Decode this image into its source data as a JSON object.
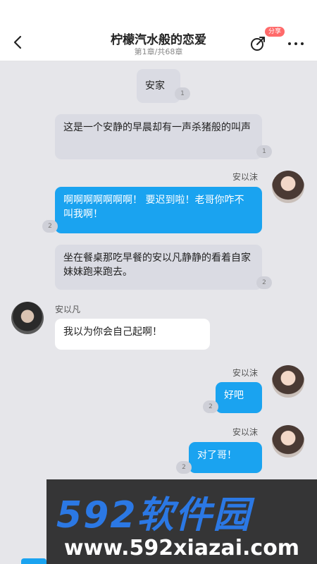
{
  "header": {
    "title": "柠檬汽水般的恋爱",
    "chapter": "第1章/共68章",
    "share_badge": "分享"
  },
  "messages": [
    {
      "text": "安家",
      "count": "1"
    },
    {
      "text": "这是一个安静的早晨却有一声杀猪般的叫声",
      "count": "1"
    },
    {
      "speaker": "安以沫",
      "text": "啊啊啊啊啊啊啊！ 要迟到啦！老哥你咋不叫我啊！",
      "count": "2"
    },
    {
      "text": "坐在餐桌那吃早餐的安以凡静静的看着自家妹妹跑来跑去。",
      "count": "2"
    },
    {
      "speaker": "安以凡",
      "text": "我以为你会自己起啊！"
    },
    {
      "speaker": "安以沫",
      "text": "好吧",
      "count": "2"
    },
    {
      "speaker": "安以沫",
      "text": "对了哥！",
      "count": "2"
    }
  ],
  "watermark": {
    "logo": "592软件园",
    "url": "www.592xiazai.com"
  },
  "icons": {
    "back": "back-arrow-icon",
    "share": "share-icon",
    "more": "more-dots-icon"
  },
  "colors": {
    "accent_blue": "#1aa3f0",
    "narration_gray": "#dadbe3",
    "badge_red": "#ff6a6a"
  }
}
